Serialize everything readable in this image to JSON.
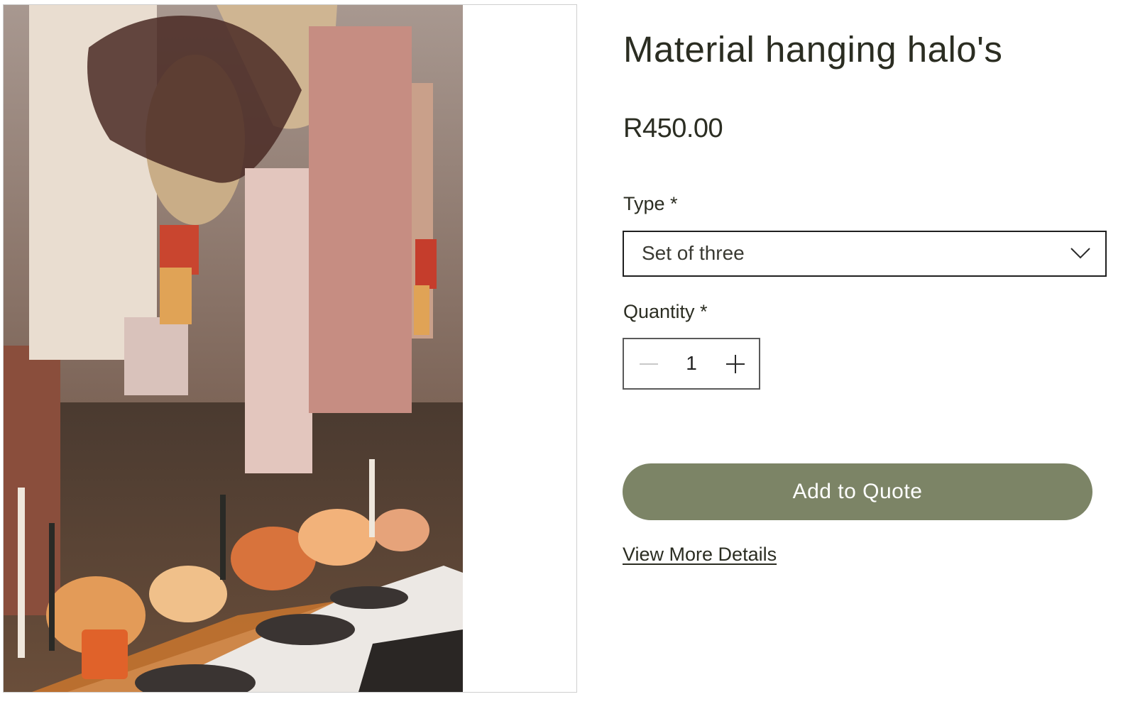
{
  "product": {
    "title": "Material hanging halo's",
    "price": "R450.00"
  },
  "options": {
    "type_label": "Type *",
    "type_selected": "Set of three",
    "quantity_label": "Quantity *",
    "quantity_value": "1"
  },
  "actions": {
    "add_to_quote": "Add to Quote",
    "view_details": "View More Details"
  },
  "icons": {
    "dropdown": "chevron-down-icon",
    "decrement": "minus-icon",
    "increment": "plus-icon"
  },
  "colors": {
    "button_bg": "#7c8466",
    "text": "#2b2d22"
  }
}
